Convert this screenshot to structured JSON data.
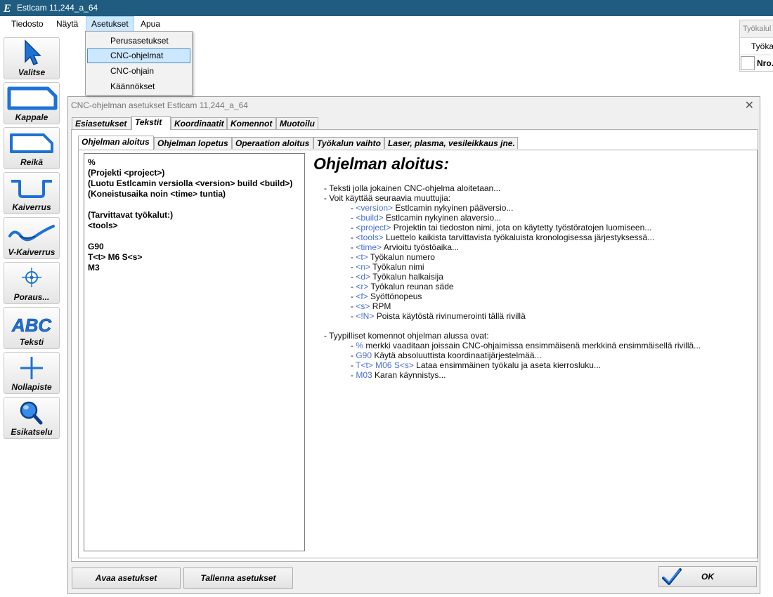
{
  "window": {
    "title": "Estlcam 11,244_a_64"
  },
  "menubar": {
    "items": [
      {
        "label": "Tiedosto"
      },
      {
        "label": "Näytä"
      },
      {
        "label": "Asetukset"
      },
      {
        "label": "Apua"
      }
    ],
    "open_menu": {
      "items": [
        {
          "label": "Perusasetukset"
        },
        {
          "label": "CNC-ohjelmat"
        },
        {
          "label": "CNC-ohjain"
        },
        {
          "label": "Käännökset"
        }
      ]
    }
  },
  "toolbar": {
    "items": [
      {
        "label": "Valitse",
        "icon": "arrow-cursor-icon"
      },
      {
        "label": "Kappale",
        "icon": "part-outline-icon"
      },
      {
        "label": "Reikä",
        "icon": "pocket-hole-icon"
      },
      {
        "label": "Kaiverrus",
        "icon": "engrave-groove-icon"
      },
      {
        "label": "V-Kaiverrus",
        "icon": "v-carve-icon"
      },
      {
        "label": "Poraus...",
        "icon": "drill-crosshair-icon"
      },
      {
        "label": "Teksti",
        "icon": "abc-text-icon"
      },
      {
        "label": "Nollapiste",
        "icon": "zero-point-cross-icon"
      },
      {
        "label": "Esikatselu",
        "icon": "magnifier-icon"
      }
    ]
  },
  "right_panel": {
    "header": "Työkalul",
    "row1": "Työkal",
    "row2": "Nro."
  },
  "dialog": {
    "title": "CNC-ohjelman asetukset Estlcam 11,244_a_64",
    "tabs": [
      {
        "label": "Esiasetukset"
      },
      {
        "label": "Tekstit"
      },
      {
        "label": "Koordinaatit"
      },
      {
        "label": "Komennot"
      },
      {
        "label": "Muotoilu"
      }
    ],
    "subtabs": [
      {
        "label": "Ohjelman aloitus"
      },
      {
        "label": "Ohjelman lopetus"
      },
      {
        "label": "Operaation aloitus"
      },
      {
        "label": "Työkalun vaihto"
      },
      {
        "label": "Laser, plasma, vesileikkaus jne."
      }
    ],
    "code_text": "%\n(Projekti <project>)\n(Luotu Estlcamin versiolla <version> build <build>)\n(Koneistusaika noin <time> tuntia)\n\n(Tarvittavat työkalut:)\n<tools>\n\nG90\nT<t> M6 S<s>\nM3",
    "help": {
      "title": "Ohjelman aloitus:",
      "intro1": "- Teksti jolla jokainen CNC-ohjelma aloitetaan...",
      "intro2": "- Voit käyttää seuraavia muuttujia:",
      "variables": [
        {
          "key": "<version>",
          "desc": " Estlcamin nykyinen pääversio..."
        },
        {
          "key": "<build>",
          "desc": "  Estlcamin nykyinen alaversio..."
        },
        {
          "key": "<project>",
          "desc": " Projektin tai tiedoston nimi, jota on käytetty työstöratojen luomiseen..."
        },
        {
          "key": "<tools>",
          "desc": "  Luettelo kaikista tarvittavista työkaluista kronologisessa järjestyksessä..."
        },
        {
          "key": "<time>",
          "desc": " Arvioitu työstöaika..."
        },
        {
          "key": "<t>",
          "desc": " Työkalun numero"
        },
        {
          "key": "<n>",
          "desc": " Työkalun nimi"
        },
        {
          "key": "<d>",
          "desc": " Työkalun halkaisija"
        },
        {
          "key": "<r>",
          "desc": " Työkalun reunan säde"
        },
        {
          "key": "<f>",
          "desc": " Syöttönopeus"
        },
        {
          "key": "<s>",
          "desc": " RPM"
        },
        {
          "key": "<!N>",
          "desc": " Poista käytöstä rivinumerointi tällä rivillä"
        }
      ],
      "typical_header": "- Tyypilliset komennot ohjelman alussa ovat:",
      "typical": [
        {
          "key": "%",
          "desc": " merkki vaaditaan joissain CNC-ohjaimissa ensimmäisenä merkkinä ensimmäisellä rivillä..."
        },
        {
          "key": "G90",
          "desc": " Käytä absoluuttista koordinaatijärjestelmää..."
        },
        {
          "key": "T<t>  M06  S<s>",
          "desc": "  Lataa ensimmäinen työkalu ja aseta kierrosluku..."
        },
        {
          "key": "M03",
          "desc": " Karan käynnistys..."
        }
      ]
    },
    "buttons": {
      "open": "Avaa asetukset",
      "save": "Tallenna asetukset",
      "ok": "OK"
    }
  },
  "colors": {
    "titlebar": "#1f5c7f",
    "variable_key": "#4a6fd0",
    "icon_blue": "#1e72d6",
    "menu_highlight": "#cce8ff"
  }
}
